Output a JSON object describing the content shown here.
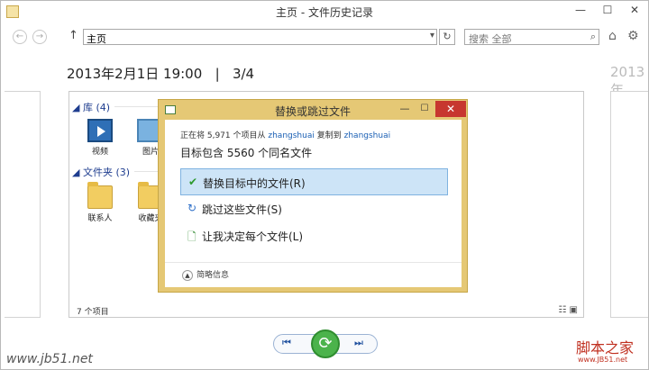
{
  "window": {
    "title": "主页 - 文件历史记录",
    "min_glyph": "—",
    "max_glyph": "☐",
    "close_glyph": "✕"
  },
  "nav": {
    "back_glyph": "←",
    "forward_glyph": "→",
    "up_glyph": "↑",
    "address": "主页",
    "search_placeholder": "搜索 全部",
    "refresh_glyph": "↻",
    "home_glyph": "⌂",
    "settings_glyph": "⚙"
  },
  "header": {
    "snapshot_date": "2013年2月1日 19:00",
    "separator": "|",
    "snapshot_index": "3/4",
    "next_snapshot_label": "2013年"
  },
  "pane": {
    "libraries_header": "库 (4)",
    "folders_header": "文件夹 (3)",
    "libraries": [
      {
        "label": "视频"
      },
      {
        "label": "图片"
      }
    ],
    "folders": [
      {
        "label": "联系人"
      },
      {
        "label": "收藏夹"
      }
    ],
    "status": "7 个项目"
  },
  "dialog": {
    "title": "替换或跳过文件",
    "copy_prefix": "正在将 5,971 个项目从",
    "copy_source": "zhangshuai",
    "copy_mid": "复制到",
    "copy_dest": "zhangshuai",
    "conflict_text": "目标包含 5560 个同名文件",
    "options": [
      {
        "label": "替换目标中的文件(R)"
      },
      {
        "label": "跳过这些文件(S)"
      },
      {
        "label": "让我决定每个文件(L)"
      }
    ],
    "details_label": "简略信息"
  },
  "controls": {
    "prev_glyph": "⏮",
    "restore_glyph": "⟳",
    "next_glyph": "⏭"
  },
  "watermark": {
    "left": "www.jb51.net",
    "right": "脚本之家",
    "right_sub": "www.JB51.net"
  },
  "colors": {
    "dialog_frame": "#e5c875",
    "close_red": "#c7372f",
    "selected_bg": "#cde4f7",
    "restore_green": "#4bb34b",
    "link_blue": "#1a5fb4"
  }
}
